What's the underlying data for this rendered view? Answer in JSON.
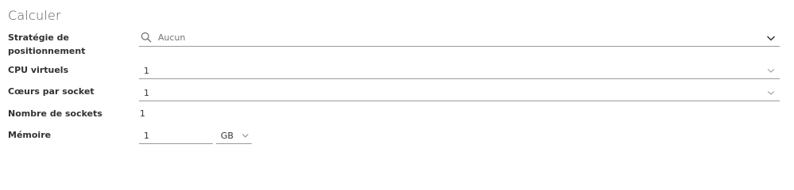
{
  "section": {
    "title": "Calculer"
  },
  "placement": {
    "label_line1": "Stratégie de",
    "label_line2": "positionnement",
    "placeholder": "Aucun"
  },
  "vcpu": {
    "label": "CPU virtuels",
    "value": "1"
  },
  "cores": {
    "label": "Cœurs par socket",
    "value": "1"
  },
  "sockets": {
    "label": "Nombre de sockets",
    "value": "1"
  },
  "memory": {
    "label": "Mémoire",
    "value": "1",
    "unit": "GB"
  },
  "icons": {
    "search": "search-icon",
    "dropdown": "chevron-down-icon"
  }
}
